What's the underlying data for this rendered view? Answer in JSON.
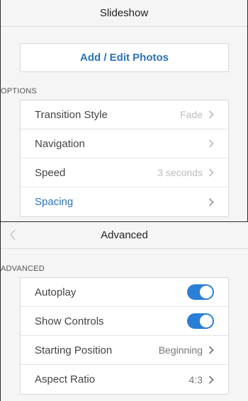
{
  "top": {
    "title": "Slideshow",
    "add_button": "Add / Edit Photos",
    "section": "OPTIONS",
    "rows": [
      {
        "label": "Transition Style",
        "value": "Fade"
      },
      {
        "label": "Navigation",
        "value": ""
      },
      {
        "label": "Speed",
        "value": "3 seconds"
      },
      {
        "label": "Spacing",
        "value": ""
      }
    ]
  },
  "bottom": {
    "title": "Advanced",
    "section": "ADVANCED",
    "rows": [
      {
        "label": "Autoplay",
        "toggle": true
      },
      {
        "label": "Show Controls",
        "toggle": true
      },
      {
        "label": "Starting Position",
        "value": "Beginning"
      },
      {
        "label": "Aspect Ratio",
        "value": "4:3"
      }
    ]
  },
  "colors": {
    "accent": "#2b73b6",
    "toggle_on": "#2b7fd6",
    "background": "#f5f5f5"
  }
}
